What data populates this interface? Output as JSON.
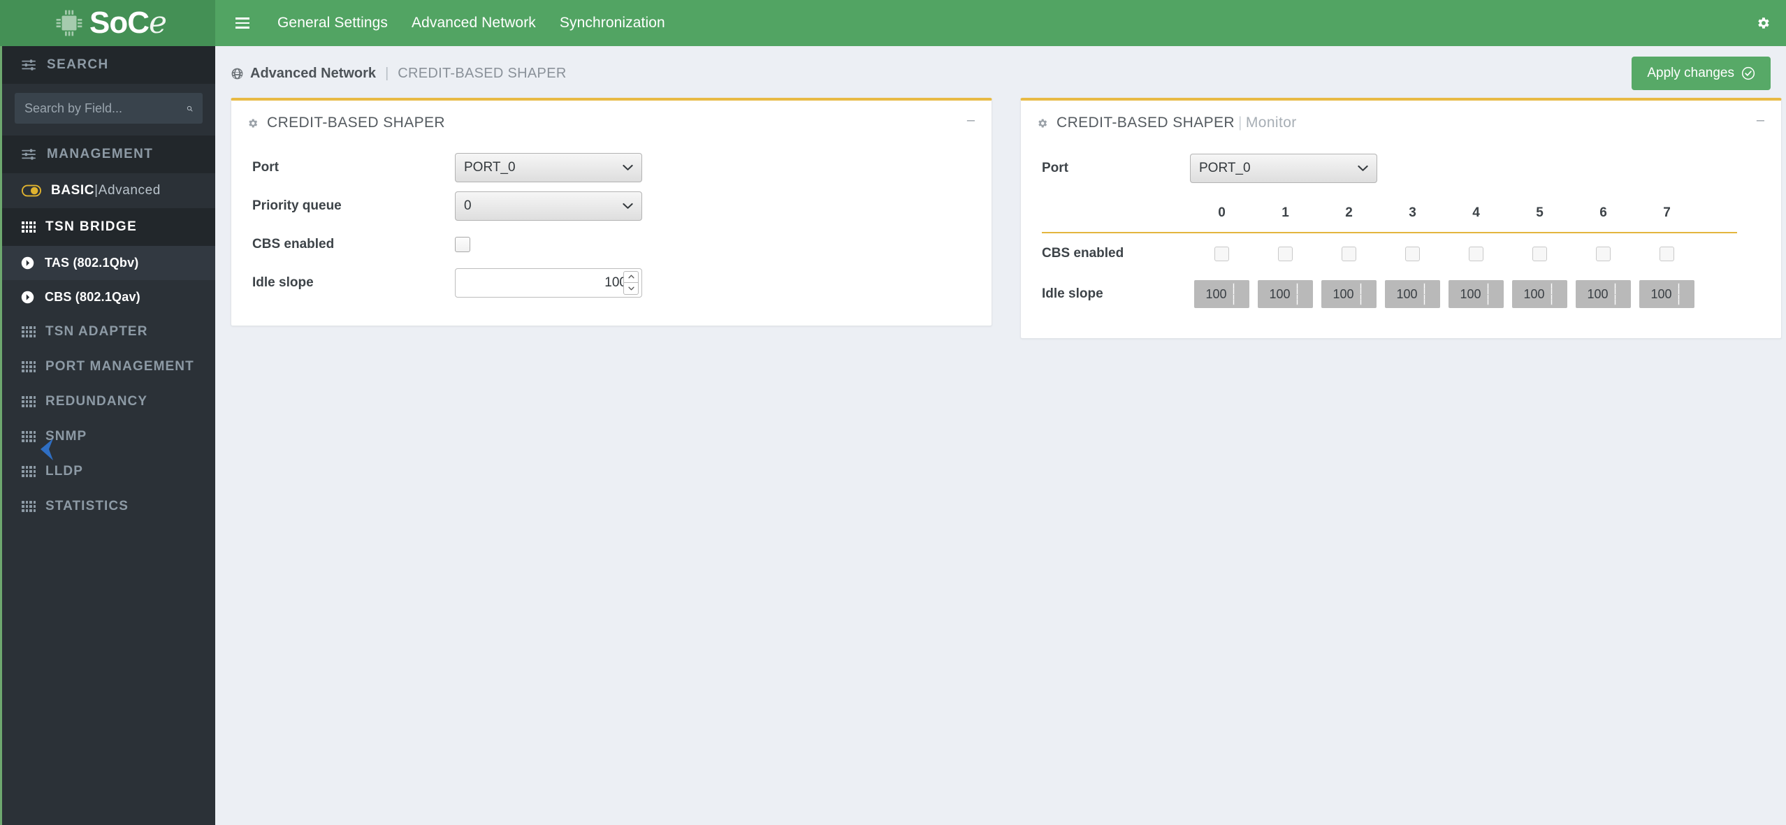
{
  "brand": {
    "name_main": "SoC",
    "name_script": "e",
    "icon": "chip-icon"
  },
  "topnav": {
    "menu_icon": "hamburger-icon",
    "items": [
      {
        "label": "General Settings"
      },
      {
        "label": "Advanced Network"
      },
      {
        "label": "Synchronization"
      }
    ],
    "settings_icon": "gear-icon"
  },
  "sidebar": {
    "search": {
      "section_label": "SEARCH",
      "section_icon": "sliders-icon",
      "placeholder": "Search by Field...",
      "search_icon": "search-icon"
    },
    "management": {
      "section_label": "MANAGEMENT",
      "section_icon": "sliders-icon",
      "toggle_icon": "toggle-icon",
      "mode_active": "BASIC",
      "mode_sep": "|",
      "mode_inactive": "Advanced"
    },
    "groups": [
      {
        "label": "TSN BRIDGE",
        "icon": "grid-icon",
        "active": true,
        "children": [
          {
            "label": "TAS (802.1Qbv)",
            "icon": "chevron-circle-right-icon"
          },
          {
            "label": "CBS (802.1Qav)",
            "icon": "chevron-circle-right-icon"
          }
        ]
      },
      {
        "label": "TSN ADAPTER",
        "icon": "grid-icon",
        "children": []
      },
      {
        "label": "PORT MANAGEMENT",
        "icon": "grid-icon",
        "children": []
      },
      {
        "label": "REDUNDANCY",
        "icon": "grid-icon",
        "children": []
      },
      {
        "label": "SNMP",
        "icon": "grid-icon",
        "children": []
      },
      {
        "label": "LLDP",
        "icon": "grid-icon",
        "children": []
      },
      {
        "label": "STATISTICS",
        "icon": "grid-icon",
        "children": []
      }
    ]
  },
  "breadcrumb": {
    "icon": "globe-icon",
    "root": "Advanced Network",
    "separator": "|",
    "current": "CREDIT-BASED SHAPER"
  },
  "apply_button": {
    "label": "Apply changes",
    "icon": "check-circle-icon"
  },
  "config_panel": {
    "icon": "gear-icon",
    "title": "CREDIT-BASED SHAPER",
    "minimize_icon": "minimize-icon",
    "minimize_label": "–",
    "fields": {
      "port_label": "Port",
      "port_value": "PORT_0",
      "priority_label": "Priority queue",
      "priority_value": "0",
      "cbs_label": "CBS enabled",
      "cbs_checked": false,
      "idle_label": "Idle slope",
      "idle_value": "100"
    }
  },
  "monitor_panel": {
    "icon": "gear-icon",
    "title": "CREDIT-BASED SHAPER",
    "title_sep": "|",
    "title_suffix": "Monitor",
    "minimize_icon": "minimize-icon",
    "minimize_label": "–",
    "port_label": "Port",
    "port_value": "PORT_0",
    "columns": [
      "0",
      "1",
      "2",
      "3",
      "4",
      "5",
      "6",
      "7"
    ],
    "rows": [
      {
        "label": "CBS enabled",
        "type": "checkbox",
        "values": [
          false,
          false,
          false,
          false,
          false,
          false,
          false,
          false
        ]
      },
      {
        "label": "Idle slope",
        "type": "spinner",
        "values": [
          "100",
          "100",
          "100",
          "100",
          "100",
          "100",
          "100",
          "100"
        ]
      }
    ]
  },
  "colors": {
    "brand_green_dark": "#449055",
    "brand_green": "#52a463",
    "sidebar_bg": "#2b3137",
    "sidebar_section_bg": "#22272b",
    "accent_gold": "#e8ba44",
    "page_bg": "#eceff4",
    "apply_green": "#57a967"
  }
}
